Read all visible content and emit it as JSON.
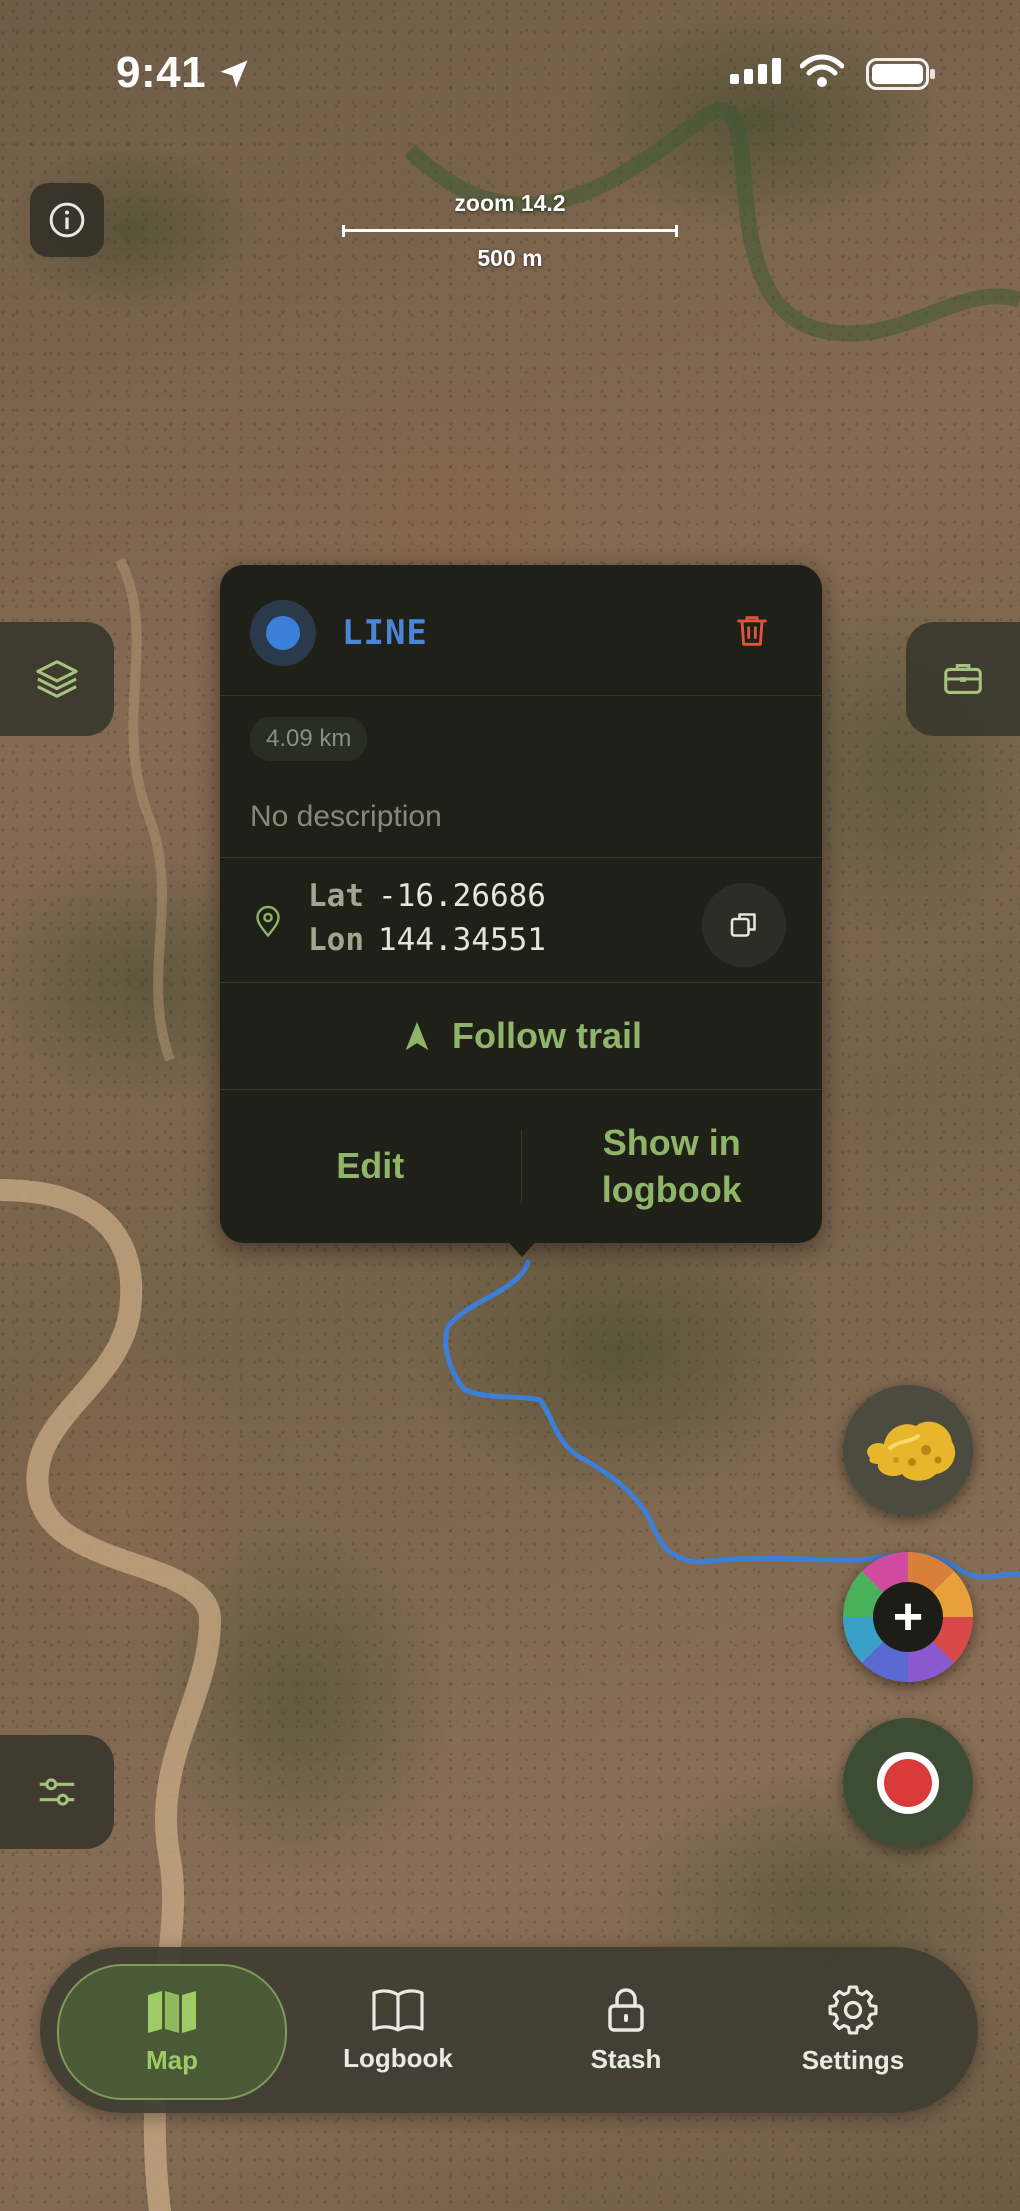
{
  "status_bar": {
    "time": "9:41"
  },
  "map": {
    "zoom_label": "zoom 14.2",
    "scale_label": "500 m",
    "trail_color": "#3c7fd8"
  },
  "popup": {
    "type_label": "LINE",
    "distance": "4.09 km",
    "description": "No description",
    "lat_key": "Lat",
    "lat_value": "-16.26686",
    "lon_key": "Lon",
    "lon_value": "144.34551",
    "follow_label": "Follow trail",
    "edit_label": "Edit",
    "show_label": "Show in logbook",
    "accent_color": "#8fb46a",
    "delete_color": "#e0543f"
  },
  "tabs": [
    {
      "label": "Map",
      "icon": "map-icon",
      "active": true
    },
    {
      "label": "Logbook",
      "icon": "book-icon",
      "active": false
    },
    {
      "label": "Stash",
      "icon": "lock-icon",
      "active": false
    },
    {
      "label": "Settings",
      "icon": "gear-icon",
      "active": false
    }
  ]
}
